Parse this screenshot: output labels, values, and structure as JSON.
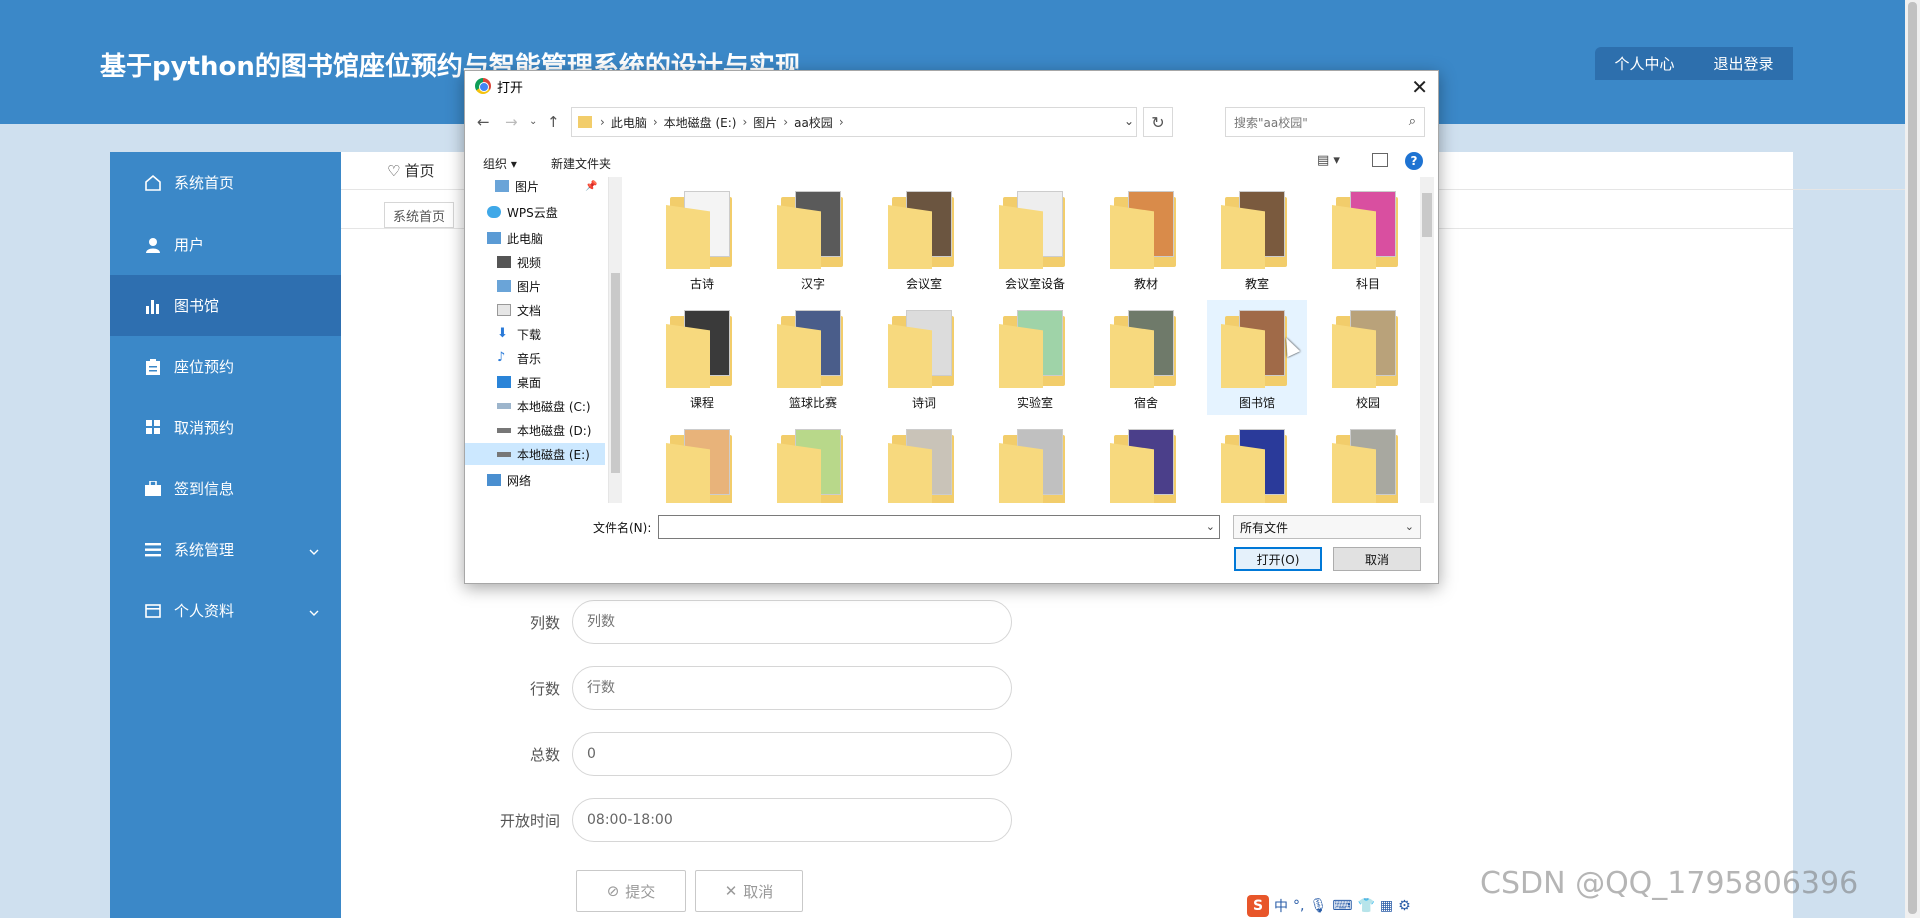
{
  "header": {
    "title": "基于python的图书馆座位预约与智能管理系统的设计与实现",
    "user_center": "个人中心",
    "logout": "退出登录"
  },
  "sidebar": {
    "items": [
      {
        "label": "系统首页",
        "icon": "home-icon"
      },
      {
        "label": "用户",
        "icon": "user-icon"
      },
      {
        "label": "图书馆",
        "icon": "bar-chart-icon",
        "active": true
      },
      {
        "label": "座位预约",
        "icon": "clipboard-icon"
      },
      {
        "label": "取消预约",
        "icon": "grid-icon"
      },
      {
        "label": "签到信息",
        "icon": "briefcase-icon"
      },
      {
        "label": "系统管理",
        "icon": "list-icon",
        "has_children": true
      },
      {
        "label": "个人资料",
        "icon": "card-icon",
        "has_children": true
      }
    ]
  },
  "breadcrumb": {
    "home": "首页"
  },
  "tabs": [
    {
      "label": "系统首页"
    }
  ],
  "form": {
    "cols": {
      "label": "列数",
      "placeholder": "列数"
    },
    "rows": {
      "label": "行数",
      "placeholder": "行数"
    },
    "total": {
      "label": "总数",
      "value": "0"
    },
    "open_time": {
      "label": "开放时间",
      "value": "08:00-18:00"
    },
    "submit": "提交",
    "cancel": "取消"
  },
  "dialog": {
    "title": "打开",
    "path": [
      "此电脑",
      "本地磁盘 (E:)",
      "图片",
      "aa校园"
    ],
    "search_placeholder": "搜索\"aa校园\"",
    "organize": "组织 ▾",
    "new_folder": "新建文件夹",
    "nav_items": [
      {
        "label": "图片",
        "icon": "pictures-icon"
      },
      {
        "label": "WPS云盘",
        "icon": "cloud-icon"
      },
      {
        "label": "此电脑",
        "icon": "computer-icon"
      },
      {
        "label": "视频",
        "icon": "video-icon"
      },
      {
        "label": "图片",
        "icon": "pictures-icon"
      },
      {
        "label": "文档",
        "icon": "document-icon"
      },
      {
        "label": "下载",
        "icon": "download-icon"
      },
      {
        "label": "音乐",
        "icon": "music-icon"
      },
      {
        "label": "桌面",
        "icon": "desktop-icon"
      },
      {
        "label": "本地磁盘 (C:)",
        "icon": "drive-icon"
      },
      {
        "label": "本地磁盘 (D:)",
        "icon": "drive-icon"
      },
      {
        "label": "本地磁盘 (E:)",
        "icon": "drive-icon",
        "selected": true
      },
      {
        "label": "网络",
        "icon": "network-icon"
      }
    ],
    "folders": [
      {
        "label": "古诗",
        "color": "#f4f4f4"
      },
      {
        "label": "汉字",
        "color": "#5a5a5a"
      },
      {
        "label": "会议室",
        "color": "#6b5540"
      },
      {
        "label": "会议室设备",
        "color": "#eeeeee"
      },
      {
        "label": "教材",
        "color": "#d98b4a"
      },
      {
        "label": "教室",
        "color": "#7a5a3e"
      },
      {
        "label": "科目",
        "color": "#d94fa0"
      },
      {
        "label": "课程",
        "color": "#3a3a3a"
      },
      {
        "label": "篮球比赛",
        "color": "#4a5d8a"
      },
      {
        "label": "诗词",
        "color": "#dcdcdc"
      },
      {
        "label": "实验室",
        "color": "#9fd3a8"
      },
      {
        "label": "宿舍",
        "color": "#6f7a6a"
      },
      {
        "label": "图书馆",
        "color": "#a06a48",
        "selected": true
      },
      {
        "label": "校园",
        "color": "#b9a27a"
      },
      {
        "label": "",
        "color": "#e8b37a"
      },
      {
        "label": "",
        "color": "#b8d88a"
      },
      {
        "label": "",
        "color": "#c9c3b8"
      },
      {
        "label": "",
        "color": "#c0c0c0"
      },
      {
        "label": "",
        "color": "#4b3f8a"
      },
      {
        "label": "",
        "color": "#2a3a9a"
      },
      {
        "label": "",
        "color": "#a8a8a0"
      }
    ],
    "filename_label": "文件名(N):",
    "filename_value": "",
    "filetype": "所有文件",
    "open_button": "打开(O)",
    "cancel_button": "取消"
  },
  "watermark": "CSDN @QQ_1795806396",
  "ime": {
    "mode": "中"
  }
}
